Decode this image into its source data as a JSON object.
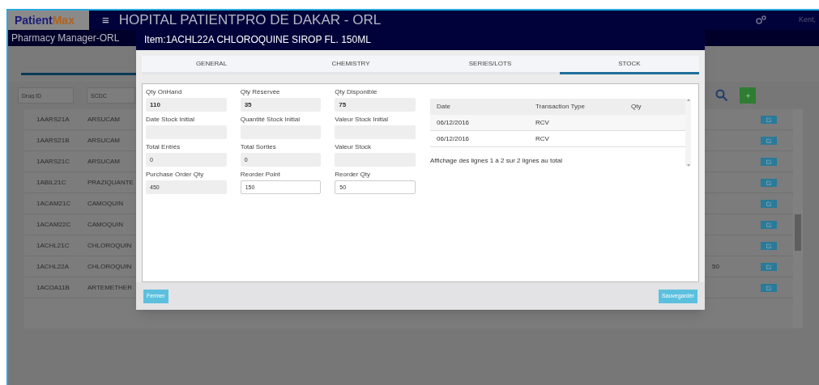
{
  "app": {
    "logo": {
      "part_1": "Patient",
      "part_2": "Max"
    },
    "menu_glyph": "≡",
    "title": "HOPITAL PATIENTPRO DE DAKAR - ORL",
    "user": "Kent,",
    "section": "Pharmacy Manager-ORL"
  },
  "filters": [
    {
      "placeholder": "Drug ID"
    },
    {
      "placeholder": "SCDC"
    }
  ],
  "drug_table": {
    "rows": [
      {
        "id": "1AARS21A",
        "name": "ARSUCAM"
      },
      {
        "id": "1AARS21B",
        "name": "ARSUCAM"
      },
      {
        "id": "1AARS21C",
        "name": "ARSUCAM"
      },
      {
        "id": "1ABIL21C",
        "name": "PRAZIQUANTE"
      },
      {
        "id": "1ACAM21C",
        "name": "CAMOQUIN"
      },
      {
        "id": "1ACAM22C",
        "name": "CAMOQUIN"
      },
      {
        "id": "1ACHL21C",
        "name": "CHLOROQUIN"
      },
      {
        "id": "1ACHL22A",
        "name": "CHLOROQUIN",
        "column_3": "50"
      },
      {
        "id": "1ACOA11B",
        "name": "ARTEMETHER"
      }
    ]
  },
  "dialog": {
    "title": "Item:1ACHL22A CHLOROQUINE SIROP FL. 150ML",
    "tabs": [
      {
        "label": "GENERAL",
        "selected": false
      },
      {
        "label": "CHEMISTRY",
        "selected": false
      },
      {
        "label": "SERIES/LOTS",
        "selected": false
      },
      {
        "label": "STOCK",
        "selected": true
      }
    ],
    "fields": [
      {
        "label": "Qty OnHand",
        "value": "110",
        "kind": "summary"
      },
      {
        "label": "Qty Réservée",
        "value": "35",
        "kind": "summary"
      },
      {
        "label": "Qty Disponible",
        "value": "75",
        "kind": "summary"
      },
      {
        "label": "Date Stock Initial",
        "kind": "readonly"
      },
      {
        "label": "Quantité Stock Initial",
        "kind": "readonly"
      },
      {
        "label": "Valeur Stock Initial",
        "kind": "readonly"
      },
      {
        "label": "Total Entrés",
        "value": "0",
        "kind": "readonly"
      },
      {
        "label": "Total Sorties",
        "value": "0",
        "kind": "readonly"
      },
      {
        "label": "Valeur Stock",
        "kind": "readonly"
      },
      {
        "label": "Purchase Order Qty",
        "value": "450",
        "kind": "readonly"
      },
      {
        "label": "Reorder Point",
        "value": "150",
        "kind": "editable"
      },
      {
        "label": "Reorder Qty",
        "value": "50",
        "kind": "editable"
      }
    ],
    "stock_table": {
      "columns": [
        "Date",
        "Transaction Type",
        "Qty"
      ],
      "rows": [
        {
          "date": "06/12/2016",
          "type": "RCV"
        },
        {
          "date": "06/12/2016",
          "type": "RCV"
        }
      ],
      "footer": "Affichage des lignes 1 à 2 sur 2 lignes au total"
    },
    "buttons": {
      "close": "Fermer",
      "save": "Sauvegarder"
    }
  }
}
